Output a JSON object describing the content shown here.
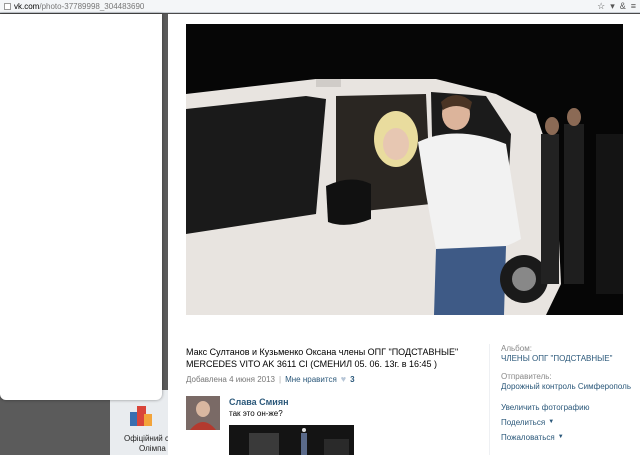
{
  "browser": {
    "url_host": "vk.com",
    "url_path": "/photo-37789998_304483690"
  },
  "background": {
    "line1": "Офіційний с",
    "line2": "Олімпа"
  },
  "photo_post": {
    "caption": "Макс Султанов и Кузьменко Оксана члены ОПГ \"ПОДСТАВНЫЕ\" MERCEDES VITO AK 3611 CI (СМЕНИЛ 05. 06. 13г. в 16:45 )",
    "date": "Добавлена 4 июня 2013",
    "separator": "|",
    "like_label": "Мне нравится",
    "like_count": "3"
  },
  "comment": {
    "author": "Слава Смиян",
    "text": "так это он-же?"
  },
  "sidebar": {
    "album_label": "Альбом:",
    "album_value": "ЧЛЕНЫ ОПГ \"ПОДСТАВНЫЕ\"",
    "sender_label": "Отправитель:",
    "sender_value": "Дорожный контроль Симферополь",
    "actions": [
      {
        "label": "Увеличить фотографию",
        "dropdown": false
      },
      {
        "label": "Поделиться",
        "dropdown": true
      },
      {
        "label": "Пожаловаться",
        "dropdown": true
      }
    ]
  },
  "icons": [
    "page-icon",
    "star-icon",
    "heart-icon",
    "chevron-down-icon",
    "vk-logo"
  ],
  "colors": {
    "link": "#2b587a",
    "muted": "#777777",
    "overlay": "#5b5b5b"
  }
}
